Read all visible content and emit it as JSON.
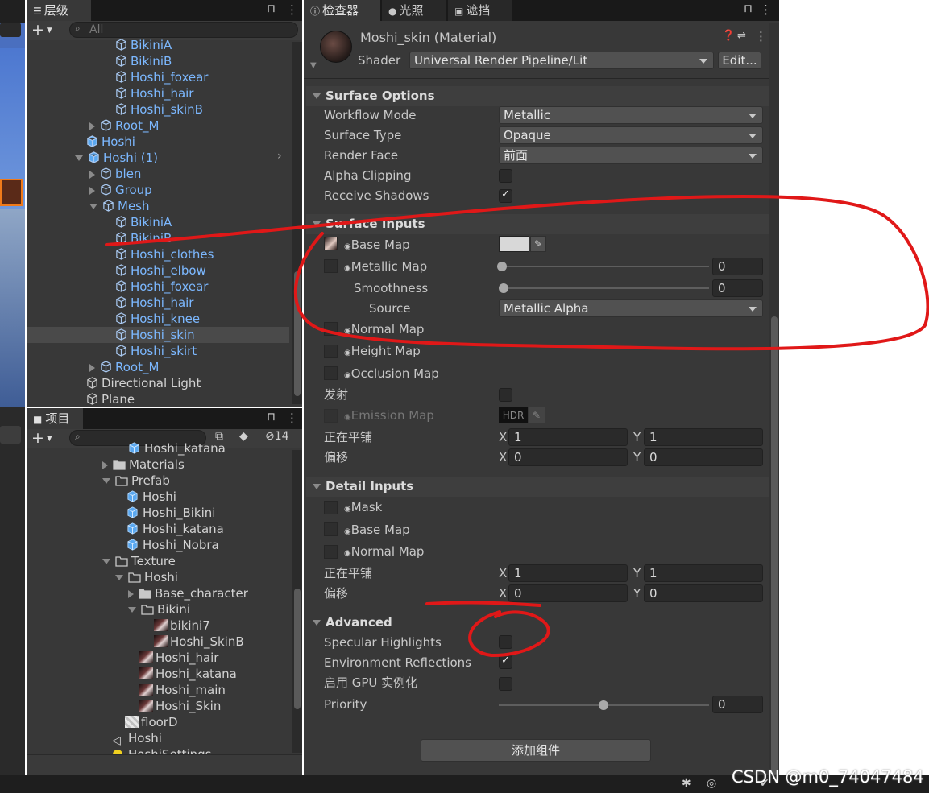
{
  "hierarchy": {
    "tab_label": "层级",
    "add_label": "+",
    "search_placeholder": "All",
    "items": [
      {
        "label": "BikiniA",
        "blue": true
      },
      {
        "label": "BikiniB",
        "blue": true
      },
      {
        "label": "Hoshi_foxear",
        "blue": true
      },
      {
        "label": "Hoshi_hair",
        "blue": true
      },
      {
        "label": "Hoshi_skinB",
        "blue": true
      },
      {
        "label": "Root_M",
        "blue": true
      },
      {
        "label": "Hoshi",
        "blue": true
      },
      {
        "label": "Hoshi (1)",
        "blue": true
      },
      {
        "label": "blen",
        "blue": true
      },
      {
        "label": "Group",
        "blue": true
      },
      {
        "label": "Mesh",
        "blue": true
      },
      {
        "label": "BikiniA",
        "blue": true
      },
      {
        "label": "BikiniB",
        "blue": true
      },
      {
        "label": "Hoshi_clothes",
        "blue": true
      },
      {
        "label": "Hoshi_elbow",
        "blue": true
      },
      {
        "label": "Hoshi_foxear",
        "blue": true
      },
      {
        "label": "Hoshi_hair",
        "blue": true
      },
      {
        "label": "Hoshi_knee",
        "blue": true
      },
      {
        "label": "Hoshi_skin",
        "blue": true
      },
      {
        "label": "Hoshi_skirt",
        "blue": true
      },
      {
        "label": "Root_M",
        "blue": true
      },
      {
        "label": "Directional Light",
        "blue": false
      },
      {
        "label": "Plane",
        "blue": false
      }
    ]
  },
  "project": {
    "tab_label": "项目",
    "add_label": "+",
    "hidden_count": "14",
    "items": [
      {
        "label": "Hoshi_katana"
      },
      {
        "label": "Materials"
      },
      {
        "label": "Prefab"
      },
      {
        "label": "Hoshi"
      },
      {
        "label": "Hoshi_Bikini"
      },
      {
        "label": "Hoshi_katana"
      },
      {
        "label": "Hoshi_Nobra"
      },
      {
        "label": "Texture"
      },
      {
        "label": "Hoshi"
      },
      {
        "label": "Base_character"
      },
      {
        "label": "Bikini"
      },
      {
        "label": "bikini7"
      },
      {
        "label": "Hoshi_SkinB"
      },
      {
        "label": "Hoshi_hair"
      },
      {
        "label": "Hoshi_katana"
      },
      {
        "label": "Hoshi_main"
      },
      {
        "label": "Hoshi_Skin"
      },
      {
        "label": "floorD"
      },
      {
        "label": "Hoshi"
      },
      {
        "label": "HoshiSettings"
      }
    ]
  },
  "inspector": {
    "tabs": [
      "检查器",
      "光照",
      "遮挡"
    ],
    "material_name": "Moshi_skin (Material)",
    "shader_label": "Shader",
    "shader_value": "Universal Render Pipeline/Lit",
    "edit_button": "Edit...",
    "surface_options": {
      "title": "Surface Options",
      "workflow_label": "Workflow Mode",
      "workflow_value": "Metallic",
      "surface_type_label": "Surface Type",
      "surface_type_value": "Opaque",
      "render_face_label": "Render Face",
      "render_face_value": "前面",
      "alpha_clipping_label": "Alpha Clipping",
      "receive_shadows_label": "Receive Shadows"
    },
    "surface_inputs": {
      "title": "Surface Inputs",
      "base_map": "Base Map",
      "metallic_map": "Metallic Map",
      "metallic_value": "0",
      "smoothness": "Smoothness",
      "smoothness_value": "0",
      "source_label": "Source",
      "source_value": "Metallic Alpha",
      "normal_map": "Normal Map",
      "height_map": "Height Map",
      "occlusion_map": "Occlusion Map",
      "emission_label": "发射",
      "emission_map": "Emission Map",
      "hdr": "HDR",
      "tiling_label": "正在平铺",
      "tiling_x": "1",
      "tiling_y": "1",
      "offset_label": "偏移",
      "offset_x": "0",
      "offset_y": "0"
    },
    "detail_inputs": {
      "title": "Detail Inputs",
      "mask": "Mask",
      "base_map": "Base Map",
      "normal_map": "Normal Map",
      "tiling_label": "正在平铺",
      "tiling_x": "1",
      "tiling_y": "1",
      "offset_label": "偏移",
      "offset_x": "0",
      "offset_y": "0"
    },
    "advanced": {
      "title": "Advanced",
      "specular_label": "Specular Highlights",
      "env_reflections_label": "Environment Reflections",
      "gpu_instancing_label": "启用 GPU 实例化",
      "priority_label": "Priority",
      "priority_value": "0"
    },
    "add_component_button": "添加组件",
    "x_label": "X",
    "y_label": "Y"
  },
  "watermark": "CSDN @m0_74047484",
  "colors": {
    "panel_bg": "#383838",
    "tab_bg": "#191919",
    "prefab_blue": "#7cb8ff",
    "annotation_red": "#e01818"
  }
}
